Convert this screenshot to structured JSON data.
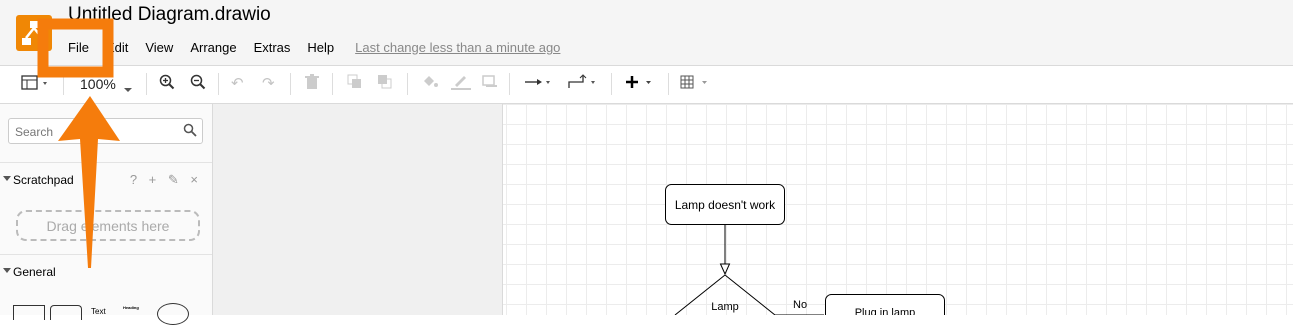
{
  "app": {
    "title": "Untitled Diagram.drawio",
    "accent_color": "#f08705"
  },
  "menu": {
    "items": [
      "File",
      "Edit",
      "View",
      "Arrange",
      "Extras",
      "Help"
    ],
    "last_change": "Last change less than a minute ago"
  },
  "toolbar": {
    "zoom": "100%",
    "icons": [
      "format-panel-icon",
      "zoom-in-icon",
      "zoom-out-icon",
      "undo-icon",
      "redo-icon",
      "delete-icon",
      "to-front-icon",
      "to-back-icon",
      "fill-color-icon",
      "line-color-icon",
      "shadow-icon",
      "connection-arrow-icon",
      "waypoints-icon",
      "insert-plus-icon",
      "table-icon"
    ]
  },
  "sidebar": {
    "search_placeholder": "Search",
    "scratchpad_label": "Scratchpad",
    "scratchpad_icons": "? + ✎ ×",
    "drag_text": "Drag elements here",
    "general_label": "General",
    "shape_text": "Text",
    "shape_heading": "Heading"
  },
  "diagram": {
    "nodes": [
      "Lamp doesn't work",
      "Lamp",
      "Plug in lamp"
    ],
    "edge_label": "No"
  },
  "annotation": {
    "highlight": "File",
    "color": "#f57c0c"
  }
}
